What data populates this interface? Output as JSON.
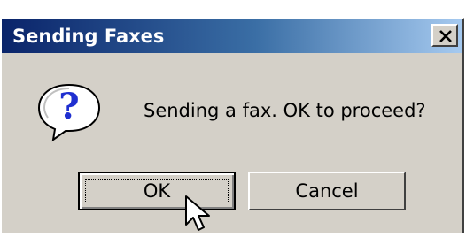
{
  "window": {
    "title": "Sending Faxes",
    "close_icon": "close-icon"
  },
  "dialog": {
    "icon": "question-icon",
    "message": "Sending a fax. OK to proceed?"
  },
  "buttons": {
    "ok_label": "OK",
    "cancel_label": "Cancel"
  },
  "colors": {
    "titlebar_start": "#0a246a",
    "titlebar_end": "#a6caf0",
    "dialog_bg": "#d4d0c8"
  }
}
